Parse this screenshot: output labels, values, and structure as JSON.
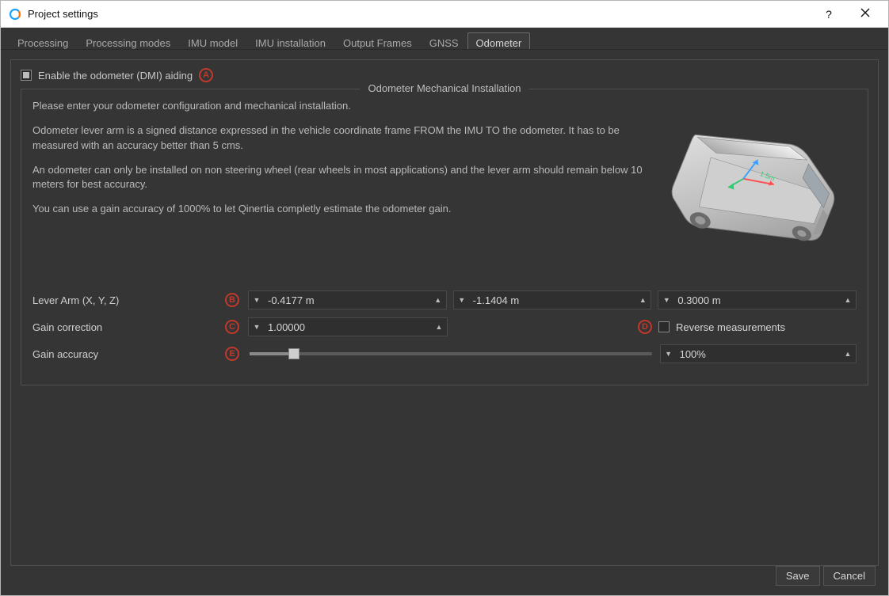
{
  "window": {
    "title": "Project settings"
  },
  "tabs": [
    {
      "label": "Processing",
      "active": false
    },
    {
      "label": "Processing modes",
      "active": false
    },
    {
      "label": "IMU model",
      "active": false
    },
    {
      "label": "IMU installation",
      "active": false
    },
    {
      "label": "Output Frames",
      "active": false
    },
    {
      "label": "GNSS",
      "active": false
    },
    {
      "label": "Odometer",
      "active": true
    }
  ],
  "enable": {
    "label": "Enable the odometer (DMI) aiding",
    "badge": "A"
  },
  "fieldset": {
    "legend": "Odometer Mechanical Installation",
    "p1": "Please enter your odometer configuration and mechanical installation.",
    "p2": "Odometer lever arm is a signed distance expressed in the vehicle coordinate frame FROM the IMU TO the odometer. It has to be measured with an accuracy better than 5 cms.",
    "p3": "An odometer can only be installed on non steering wheel (rear wheels in most applications) and the lever arm should remain below 10 meters for best accuracy.",
    "p4": "You can use a gain accuracy of 1000% to let Qinertia completly estimate the odometer gain."
  },
  "form": {
    "lever_label": "Lever Arm (X, Y, Z)",
    "lever_badge": "B",
    "lever_x": "-0.4177 m",
    "lever_y": "-1.1404 m",
    "lever_z": "0.3000 m",
    "gain_corr_label": "Gain correction",
    "gain_corr_badge": "C",
    "gain_corr_value": "1.00000",
    "reverse_badge": "D",
    "reverse_label": "Reverse measurements",
    "gain_acc_label": "Gain accuracy",
    "gain_acc_badge": "E",
    "gain_acc_value": "100%"
  },
  "footer": {
    "save": "Save",
    "cancel": "Cancel"
  }
}
